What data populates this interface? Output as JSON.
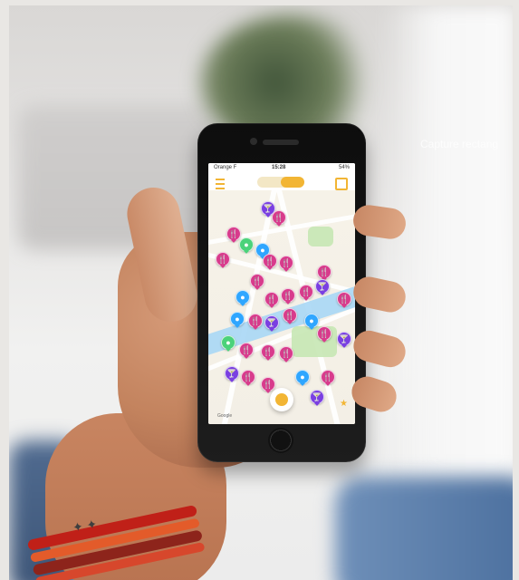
{
  "overlay_text": "Capture rectang",
  "phone": {
    "status_bar": {
      "carrier": "Orange F",
      "time": "15:28",
      "battery": "54%"
    },
    "map": {
      "attribution": "Google"
    }
  },
  "colors": {
    "accent": "#f2b534",
    "pin_primary": "#d83b8c",
    "pin_secondary": "#7a3fe1",
    "pin_alt": "#2fa6ff",
    "pin_green": "#4bd27a"
  },
  "icons": {
    "menu": "menu-icon",
    "filter": "filter-icon",
    "locate": "locate-icon",
    "pin": "map-pin-icon"
  }
}
